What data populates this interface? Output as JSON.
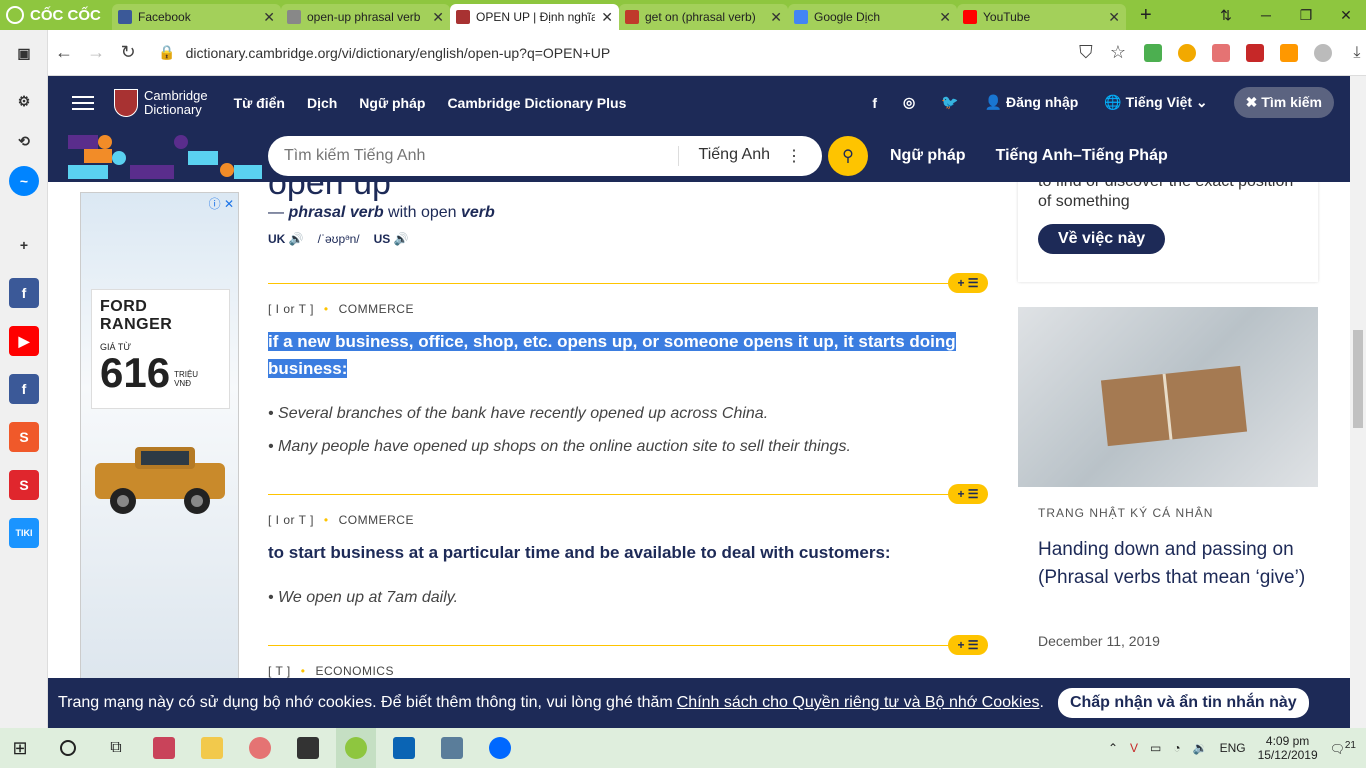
{
  "browser": {
    "brand": "CỐC CỐC",
    "tabs": [
      {
        "title": "Facebook",
        "color": "#3b5998"
      },
      {
        "title": "open-up phrasal verb",
        "color": "#888"
      },
      {
        "title": "OPEN UP | Định nghĩa",
        "color": "#a83232",
        "active": true
      },
      {
        "title": "get on (phrasal verb)",
        "color": "#c0392b"
      },
      {
        "title": "Google Dịch",
        "color": "#4285f4"
      },
      {
        "title": "YouTube",
        "color": "#ff0000"
      }
    ],
    "url": "dictionary.cambridge.org/vi/dictionary/english/open-up?q=OPEN+UP"
  },
  "site": {
    "logo_line1": "Cambridge",
    "logo_line2": "Dictionary",
    "menu": [
      "Từ điển",
      "Dịch",
      "Ngữ pháp",
      "Cambridge Dictionary Plus"
    ],
    "login": "Đăng nhập",
    "language": "Tiếng Việt",
    "search_toggle": "Tìm kiếm",
    "search_placeholder": "Tìm kiếm Tiếng Anh",
    "search_dict": "Tiếng Anh",
    "links": [
      "Ngữ pháp",
      "Tiếng Anh–Tiếng Pháp"
    ]
  },
  "ad": {
    "brand": "FORD RANGER",
    "from": "GIÁ TỪ",
    "price": "616",
    "unit1": "TRIỆU",
    "unit2": "VNĐ"
  },
  "entry": {
    "headword": "open up",
    "pos_prefix": "— ",
    "pos": "phrasal verb",
    "pos_with": " with open ",
    "pos_verb": "verb",
    "uk": "UK",
    "ipa": "/ˈəʊpᵊn/",
    "us": "US",
    "senses": [
      {
        "gram": "[ I or T ]",
        "domain": "COMMERCE",
        "def": "if a new business, office, shop, etc. opens up, or someone opens it up, it starts doing business:",
        "examples": [
          "Several branches of the bank have recently opened up across China.",
          "Many people have opened up shops on the online auction site to sell their things."
        ]
      },
      {
        "gram": "[ I or T ]",
        "domain": "COMMERCE",
        "def": "to start business at a particular time and be available to deal with customers:",
        "examples": [
          "We open up at 7am daily."
        ]
      },
      {
        "gram": "[ T ]",
        "domain": "ECONOMICS"
      }
    ],
    "plus_label": "+ ☰"
  },
  "right": {
    "top_text_line1": "to find or discover the exact position",
    "top_text_line2": "of something",
    "about_btn": "Về việc này",
    "kicker": "TRANG NHẬT KÝ CÁ NHÂN",
    "headline": "Handing down and passing on (Phrasal verbs that mean ‘give’)",
    "date": "December 11, 2019"
  },
  "cookie": {
    "text": "Trang mạng này có sử dụng bộ nhớ cookies. Để biết thêm thông tin, vui lòng ghé thăm",
    "link": "Chính sách cho Quyền riêng tư và Bộ nhớ Cookies",
    "button": "Chấp nhận và ẩn tin nhắn này"
  },
  "taskbar": {
    "lang": "ENG",
    "time": "4:09 pm",
    "date": "15/12/2019",
    "notif": "21"
  }
}
